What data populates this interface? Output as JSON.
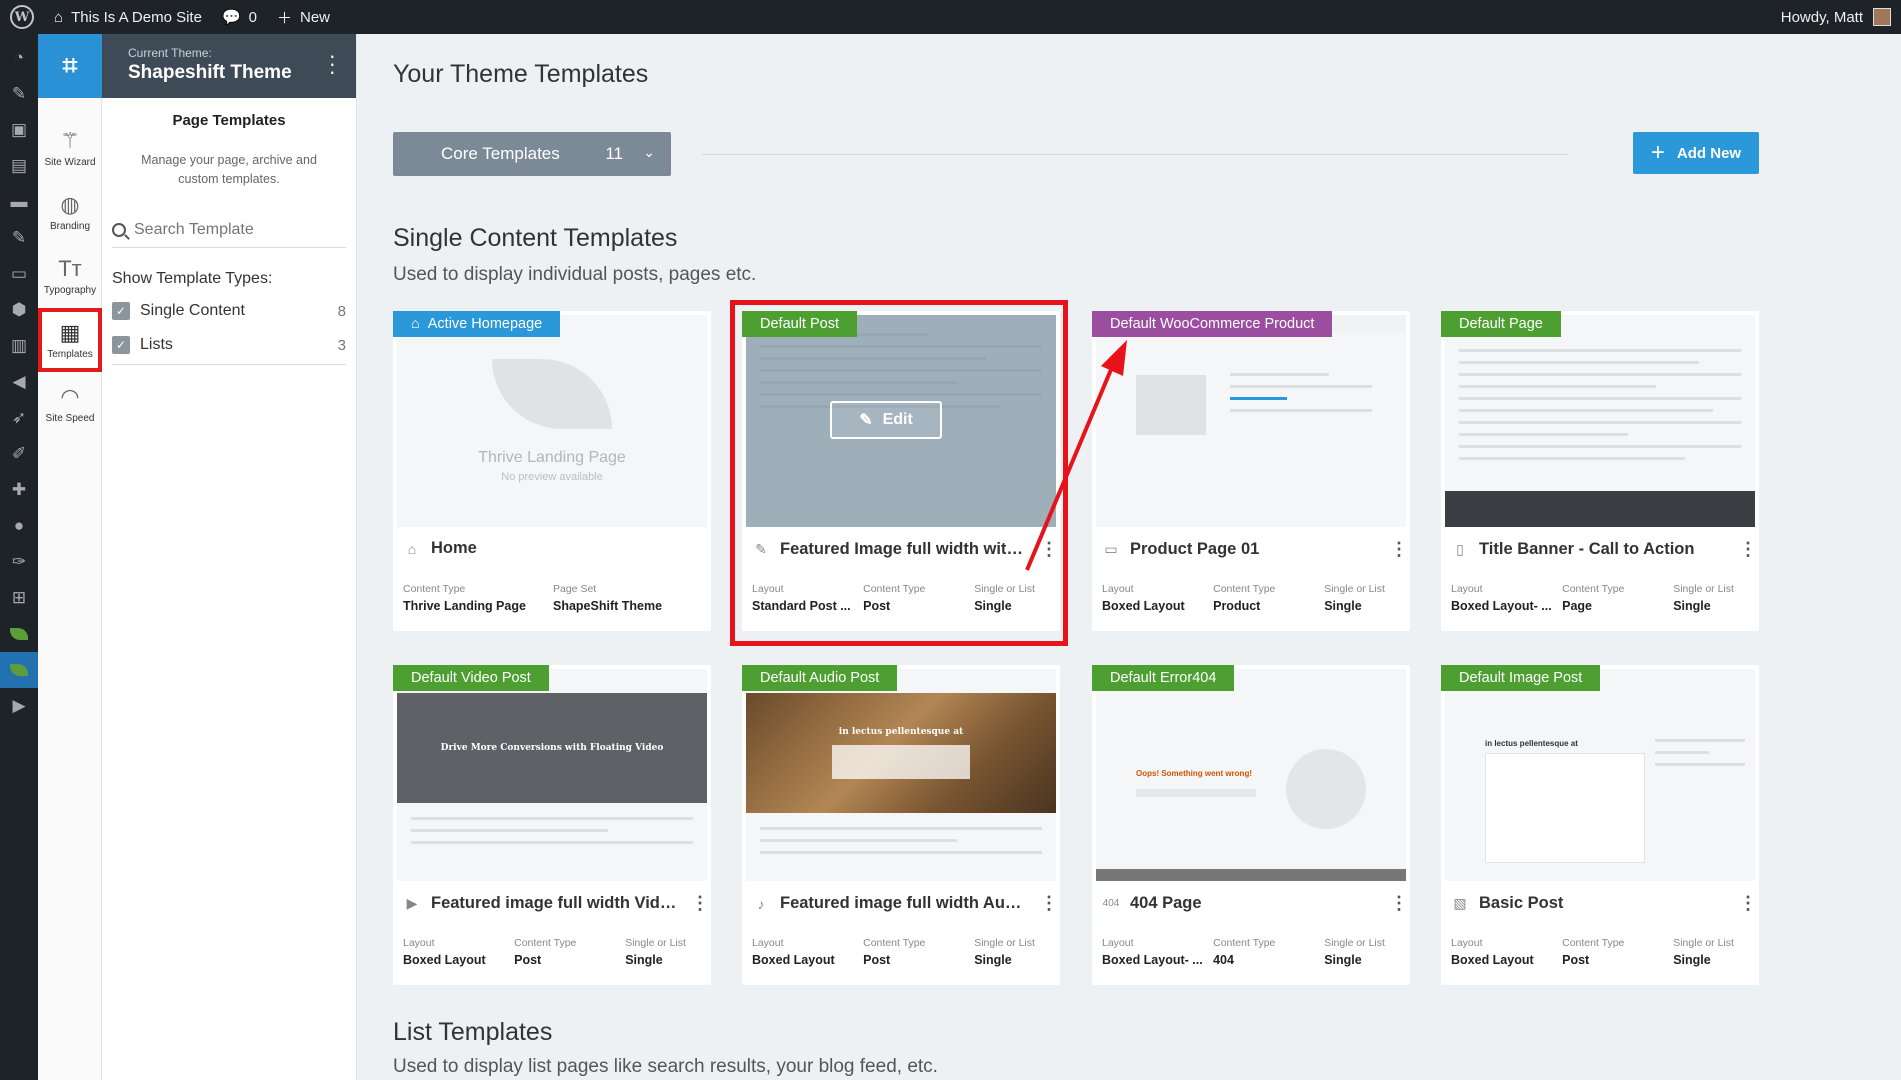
{
  "adminbar": {
    "site_name": "This Is A Demo Site",
    "comments_count": "0",
    "new_label": "New",
    "howdy": "Howdy, Matt"
  },
  "thrive_nav": {
    "items": [
      {
        "label": "Site Wizard",
        "icon": "magic-wand-icon"
      },
      {
        "label": "Branding",
        "icon": "palette-icon"
      },
      {
        "label": "Typography",
        "icon": "typography-icon"
      },
      {
        "label": "Templates",
        "icon": "templates-icon",
        "active": true
      },
      {
        "label": "Site Speed",
        "icon": "speedometer-icon"
      }
    ]
  },
  "panel": {
    "current_theme_label": "Current Theme:",
    "theme_name": "Shapeshift Theme",
    "title": "Page Templates",
    "description": "Manage your page, archive and custom templates.",
    "search_placeholder": "Search Template",
    "show_types_label": "Show Template Types:",
    "types": [
      {
        "label": "Single Content",
        "count": "8",
        "checked": true
      },
      {
        "label": "Lists",
        "count": "3",
        "checked": true
      }
    ]
  },
  "main": {
    "page_title": "Your Theme Templates",
    "core_templates_label": "Core Templates",
    "core_templates_count": "11",
    "add_new_label": "Add New",
    "single_section_title": "Single Content Templates",
    "single_section_sub": "Used to display individual posts, pages etc.",
    "list_section_title": "List Templates",
    "list_section_sub": "Used to display list pages like search results, your blog feed, etc."
  },
  "cards": [
    {
      "badge": "Active Homepage",
      "title": "Home",
      "k1": "Content Type",
      "v1": "Thrive Landing Page",
      "k2": "Page Set",
      "v2": "ShapeShift Theme",
      "k3": "",
      "v3": "",
      "preview_name": "Thrive Landing Page",
      "preview_sub": "No preview available"
    },
    {
      "badge": "Default Post",
      "title": "Featured Image full width with ...",
      "k1": "Layout",
      "v1": "Standard Post ...",
      "k2": "Content Type",
      "v2": "Post",
      "k3": "Single or List",
      "v3": "Single",
      "edit_label": "Edit"
    },
    {
      "badge": "Default WooCommerce Product",
      "title": "Product Page 01",
      "k1": "Layout",
      "v1": "Boxed Layout",
      "k2": "Content Type",
      "v2": "Product",
      "k3": "Single or List",
      "v3": "Single"
    },
    {
      "badge": "Default Page",
      "title": "Title Banner - Call to Action",
      "k1": "Layout",
      "v1": "Boxed Layout- ...",
      "k2": "Content Type",
      "v2": "Page",
      "k3": "Single or List",
      "v3": "Single"
    },
    {
      "badge": "Default Video Post",
      "title": "Featured image full width Video...",
      "k1": "Layout",
      "v1": "Boxed Layout",
      "k2": "Content Type",
      "v2": "Post",
      "k3": "Single or List",
      "v3": "Single",
      "preview_text": "Drive More Conversions with Floating Video"
    },
    {
      "badge": "Default Audio Post",
      "title": "Featured image full width Audio...",
      "k1": "Layout",
      "v1": "Boxed Layout",
      "k2": "Content Type",
      "v2": "Post",
      "k3": "Single or List",
      "v3": "Single",
      "preview_text": "in lectus pellentesque at"
    },
    {
      "badge": "Default Error404",
      "title": "404 Page",
      "k1": "Layout",
      "v1": "Boxed Layout- ...",
      "k2": "Content Type",
      "v2": "404",
      "k3": "Single or List",
      "v3": "Single",
      "title_icon": "404",
      "preview_text": "Oops! Something went wrong!"
    },
    {
      "badge": "Default Image Post",
      "title": "Basic Post",
      "k1": "Layout",
      "v1": "Boxed Layout",
      "k2": "Content Type",
      "v2": "Post",
      "k3": "Single or List",
      "v3": "Single",
      "preview_text": "in lectus pellentesque at"
    }
  ],
  "colors": {
    "accent_blue": "#2a98d9",
    "badge_green": "#4c9f30",
    "badge_purple": "#9b4ea0",
    "highlight_red": "#e8131a"
  }
}
